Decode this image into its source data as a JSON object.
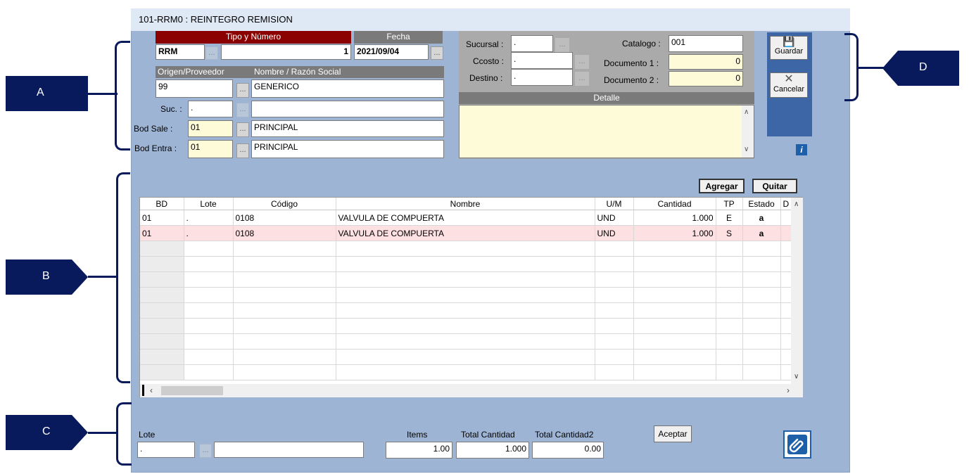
{
  "window": {
    "title": "101-RRM0 : REINTEGRO REMISION"
  },
  "header": {
    "tipo_numero_label": "Tipo y Número",
    "fecha_label": "Fecha",
    "tipo_value": "RRM",
    "numero_value": "1",
    "fecha_value": "2021/09/04",
    "origen_label": "Origen/Proveedor",
    "nombre_label": "Nombre / Razón Social",
    "origen_value": "99",
    "nombre_value": "GENERICO",
    "suc_label": "Suc. :",
    "suc_value": ".",
    "suc_name": "",
    "bod_sale_label": "Bod Sale :",
    "bod_sale_value": "01",
    "bod_sale_name": "PRINCIPAL",
    "bod_entra_label": "Bod Entra :",
    "bod_entra_value": "01",
    "bod_entra_name": "PRINCIPAL",
    "dots": "..."
  },
  "right_panel": {
    "sucursal_label": "Sucursal :",
    "sucursal_value": ".",
    "ccosto_label": "Ccosto :",
    "ccosto_value": ".",
    "destino_label": "Destino :",
    "destino_value": ".",
    "catalogo_label": "Catalogo :",
    "catalogo_value": "001",
    "documento1_label": "Documento 1 :",
    "documento1_value": "0",
    "documento2_label": "Documento 2 :",
    "documento2_value": "0",
    "detalle_label": "Detalle",
    "detalle_value": ""
  },
  "actions": {
    "guardar": "Guardar",
    "cancelar": "Cancelar",
    "agregar": "Agregar",
    "quitar": "Quitar",
    "aceptar": "Aceptar",
    "info": "i"
  },
  "grid": {
    "columns": [
      "BD",
      "Lote",
      "Código",
      "Nombre",
      "U/M",
      "Cantidad",
      "TP",
      "Estado",
      "D"
    ],
    "rows": [
      {
        "bd": "01",
        "lote": ".",
        "codigo": "0108",
        "nombre": "VALVULA DE COMPUERTA",
        "um": "UND",
        "cantidad": "1.000",
        "tp": "E",
        "estado": "a"
      },
      {
        "bd": "01",
        "lote": ".",
        "codigo": "0108",
        "nombre": "VALVULA DE COMPUERTA",
        "um": "UND",
        "cantidad": "1.000",
        "tp": "S",
        "estado": "a"
      }
    ]
  },
  "footer": {
    "lote_label": "Lote",
    "lote_value": ".",
    "lote_name": "",
    "items_label": "Items",
    "items_value": "1.00",
    "total_cantidad_label": "Total Cantidad",
    "total_cantidad_value": "1.000",
    "total_cantidad2_label": "Total Cantidad2",
    "total_cantidad2_value": "0.00"
  },
  "callouts": {
    "a": "A",
    "b": "B",
    "c": "C",
    "d": "D"
  },
  "colors": {
    "window_bg": "#9eb4d4",
    "header_red": "#8b0000",
    "callout_navy": "#081a5c",
    "highlight_row": "#fde0e2",
    "field_yellow": "#fefbd8"
  }
}
